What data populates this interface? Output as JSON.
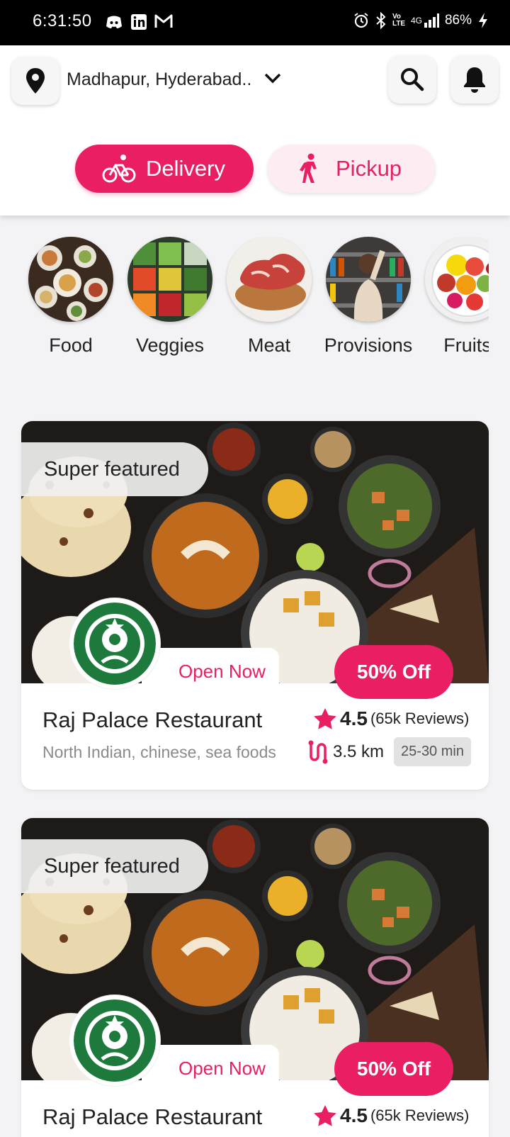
{
  "status_bar": {
    "time": "6:31:50",
    "network": "4G",
    "lte": "Vo LTE",
    "battery": "86%",
    "left_icons": [
      "discord-icon",
      "linkedin-icon",
      "gmail-icon"
    ],
    "right_icons": [
      "alarm-icon",
      "bluetooth-icon",
      "signal-icon",
      "charging-icon"
    ]
  },
  "header": {
    "location": "Madhapur, Hyderabad..",
    "icons": [
      "location-pin-icon",
      "chevron-down-icon",
      "search-icon",
      "bell-icon"
    ],
    "modes": {
      "delivery": "Delivery",
      "pickup": "Pickup",
      "selected": "delivery"
    }
  },
  "categories": [
    {
      "label": "Food"
    },
    {
      "label": "Veggies"
    },
    {
      "label": "Meat"
    },
    {
      "label": "Provisions"
    },
    {
      "label": "Fruits"
    }
  ],
  "restaurants": [
    {
      "badge": "Super featured",
      "status": "Open Now",
      "discount": "50% Off",
      "name": "Raj Palace Restaurant",
      "cuisine": "North Indian, chinese, sea foods",
      "rating": "4.5",
      "reviews": "(65k Reviews)",
      "distance": "3.5 km",
      "eta": "25-30 min"
    },
    {
      "badge": "Super featured",
      "status": "Open Now",
      "discount": "50% Off",
      "name": "Raj Palace Restaurant",
      "rating": "4.5",
      "reviews": "(65k Reviews)"
    }
  ],
  "colors": {
    "accent": "#e91e63",
    "accent_light": "#fdecf1",
    "background": "#f3f3f5"
  }
}
